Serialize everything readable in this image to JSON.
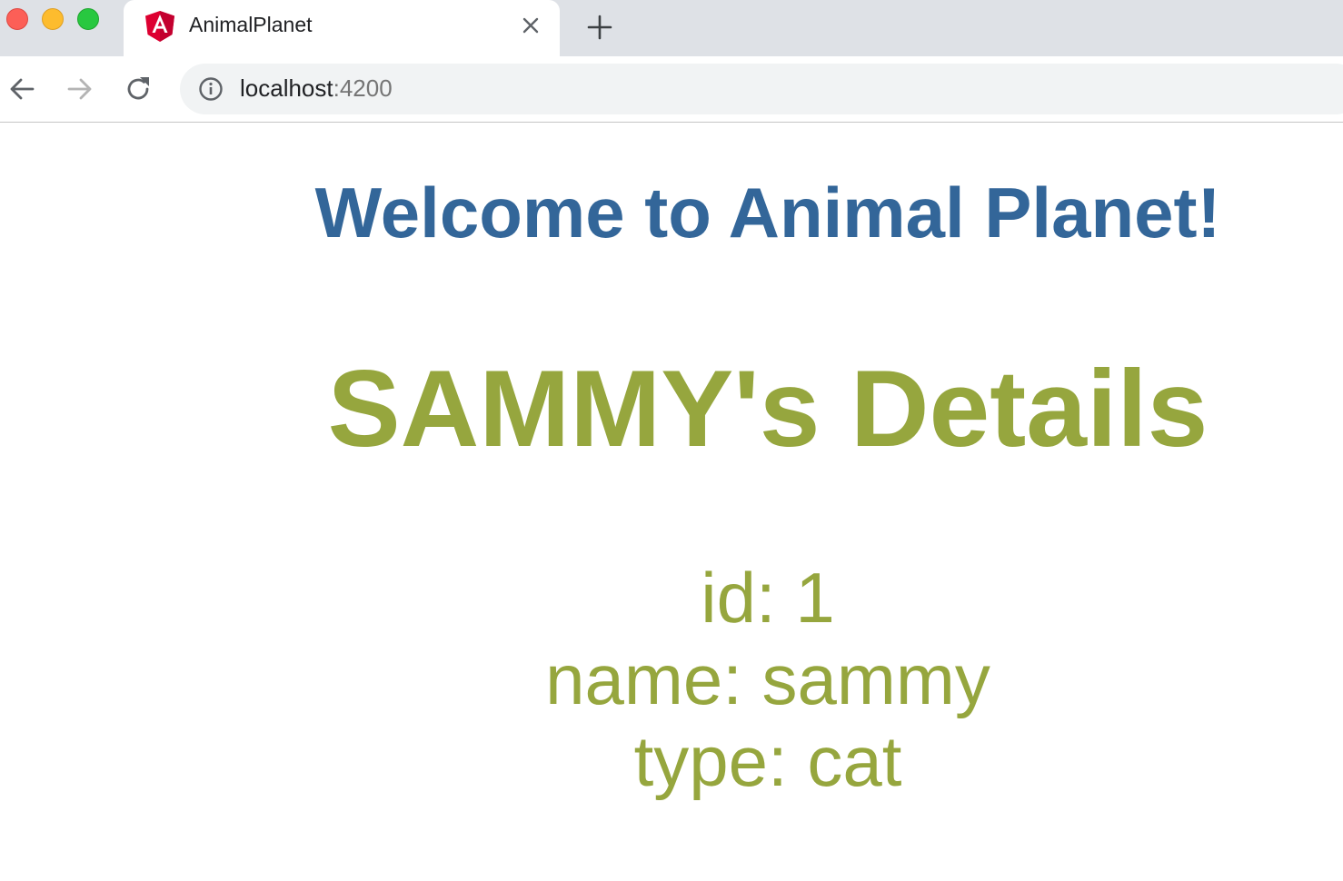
{
  "browser": {
    "tab": {
      "title": "AnimalPlanet",
      "favicon": "angular-icon"
    },
    "address_bar": {
      "host": "localhost",
      "port": ":4200"
    },
    "colors": {
      "tabstrip": "#dee1e6",
      "omnibox": "#f1f3f4"
    }
  },
  "page": {
    "heading": "Welcome to Animal Planet!",
    "details_title": "SAMMY's Details",
    "details": {
      "id_line": "id: 1",
      "name_line": "name: sammy",
      "type_line": "type: cat"
    },
    "colors": {
      "heading": "#336699",
      "details": "#96a63e"
    }
  }
}
